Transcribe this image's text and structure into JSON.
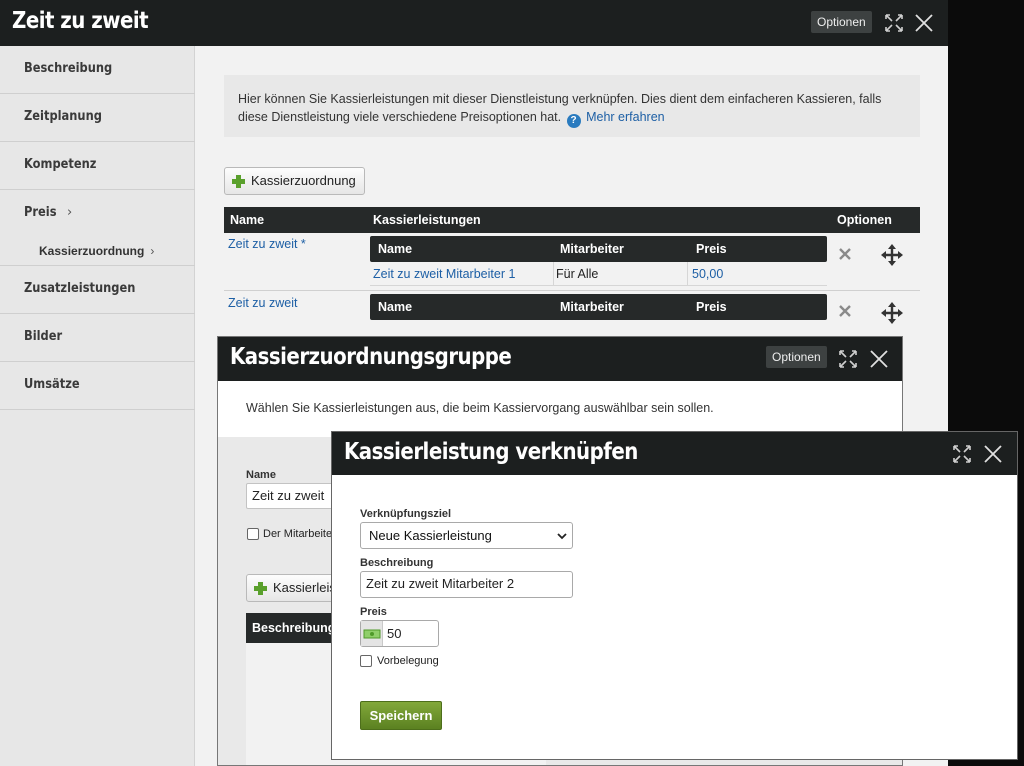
{
  "main_window": {
    "title": "Zeit zu zweit",
    "options_label": "Optionen",
    "sidebar": {
      "items": [
        {
          "label": "Beschreibung"
        },
        {
          "label": "Zeitplanung"
        },
        {
          "label": "Kompetenz"
        },
        {
          "label": "Preis",
          "chevron": "›"
        },
        {
          "label": "Zusatzleistungen"
        },
        {
          "label": "Bilder"
        },
        {
          "label": "Umsätze"
        }
      ],
      "sub_item": {
        "label": "Kassierzuordnung",
        "chevron": "›"
      }
    },
    "info_text": "Hier können Sie Kassierleistungen mit dieser Dienstleistung verknüpfen. Dies dient dem einfacheren Kassieren, falls diese Dienstleistung viele verschiedene Preisoptionen hat.",
    "info_link": "Mehr erfahren",
    "help_icon_glyph": "?",
    "add_button_label": "Kassierzuordnung",
    "table": {
      "headers": [
        "Name",
        "Kassierleistungen",
        "Optionen"
      ],
      "sub_headers": [
        "Name",
        "Mitarbeiter",
        "Preis"
      ],
      "rows": [
        {
          "name": "Zeit zu zweit *",
          "items": [
            {
              "name": "Zeit zu zweit Mitarbeiter 1",
              "staff": "Für Alle",
              "price": "50,00"
            }
          ]
        },
        {
          "name": "Zeit zu zweit",
          "items": []
        }
      ]
    }
  },
  "group_window": {
    "title": "Kassierzuordnungsgruppe",
    "options_label": "Optionen",
    "description": "Wählen Sie Kassierleistungen aus, die beim Kassiervorgang auswählbar sein sollen.",
    "name_label": "Name",
    "name_value": "Zeit zu zweit",
    "checkbox_label": "Der Mitarbeite",
    "add_button_label": "Kassierleis",
    "table_header": "Beschreibung"
  },
  "link_dialog": {
    "title": "Kassierleistung verknüpfen",
    "target_label": "Verknüpfungsziel",
    "target_value": "Neue Kassierleistung",
    "description_label": "Beschreibung",
    "description_value": "Zeit zu zweit Mitarbeiter 2",
    "price_label": "Preis",
    "price_value": "50",
    "checkbox_label": "Vorbelegung",
    "save_label": "Speichern"
  },
  "colors": {
    "title_bar": "#1c1f1f",
    "link": "#1d5fa5",
    "add_plus": "#5aa02c",
    "save_button": "#6b9329"
  },
  "icons": [
    "expand-icon",
    "close-icon",
    "plus-icon",
    "help-icon",
    "delete-icon",
    "move-icon",
    "money-icon",
    "chevron-down-icon"
  ]
}
